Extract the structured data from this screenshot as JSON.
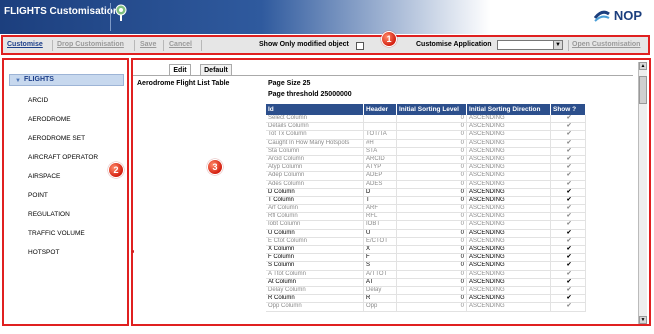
{
  "header": {
    "title": "FLIGHTS Customisation",
    "logo_text": "NOP"
  },
  "toolbar": {
    "customise": "Customise",
    "drop_customisation": "Drop Customisation",
    "save": "Save",
    "cancel": "Cancel",
    "show_modified_label": "Show Only modified object",
    "customise_application_label": "Customise Application",
    "customise_application_value": "",
    "open_customisation": "Open Customisation"
  },
  "badges": {
    "b1": "1",
    "b2": "2",
    "b3": "3"
  },
  "sidebar": {
    "title": "FLIGHTS",
    "items": [
      "ARCID",
      "AERODROME",
      "AERODROME SET",
      "AIRCRAFT OPERATOR",
      "AIRSPACE",
      "POINT",
      "REGULATION",
      "TRAFFIC VOLUME",
      "HOTSPOT"
    ]
  },
  "main": {
    "tabs": [
      "Edit",
      "Default"
    ],
    "table_title": "Aerodrome Flight List Table",
    "page_size": "Page Size 25",
    "page_threshold": "Page threshold 25000000",
    "columns": [
      "Id",
      "Header",
      "Initial Sorting Level",
      "Initial Sorting Direction",
      "Show ?"
    ],
    "rows": [
      [
        "Select Column",
        "",
        "0",
        "ASCENDING",
        "✔",
        "grey"
      ],
      [
        "Details Column",
        "",
        "0",
        "ASCENDING",
        "✔",
        "grey"
      ],
      [
        "Tot Tx Column",
        "TOT/TA",
        "0",
        "ASCENDING",
        "✔",
        "grey"
      ],
      [
        "Caught In How Many Hotspots",
        "#H",
        "0",
        "ASCENDING",
        "✔",
        "grey"
      ],
      [
        "Sta Column",
        "STA",
        "0",
        "ASCENDING",
        "✔",
        "grey"
      ],
      [
        "Arcid Column",
        "ARCID",
        "0",
        "ASCENDING",
        "✔",
        "grey"
      ],
      [
        "Atyp Column",
        "ATYP",
        "0",
        "ASCENDING",
        "✔",
        "grey"
      ],
      [
        "Adep Column",
        "ADEP",
        "0",
        "ASCENDING",
        "✔",
        "grey"
      ],
      [
        "Ades Column",
        "ADES",
        "0",
        "ASCENDING",
        "✔",
        "grey"
      ],
      [
        "D Column",
        "D",
        "0",
        "ASCENDING",
        "✔",
        "black"
      ],
      [
        "T Column",
        "T",
        "0",
        "ASCENDING",
        "✔",
        "black"
      ],
      [
        "Arf Column",
        "ARF",
        "0",
        "ASCENDING",
        "✔",
        "grey"
      ],
      [
        "Rfl Column",
        "RFL",
        "0",
        "ASCENDING",
        "✔",
        "grey"
      ],
      [
        "Iobt Column",
        "IOBT",
        "0",
        "ASCENDING",
        "✔",
        "grey"
      ],
      [
        "U Column",
        "U",
        "0",
        "ASCENDING",
        "✔",
        "black"
      ],
      [
        "E Ctot Column",
        "E/CTOT",
        "0",
        "ASCENDING",
        "✔",
        "grey"
      ],
      [
        "X Column",
        "X",
        "0",
        "ASCENDING",
        "✔",
        "black"
      ],
      [
        "F Column",
        "F",
        "0",
        "ASCENDING",
        "✔",
        "black"
      ],
      [
        "S Column",
        "S",
        "0",
        "ASCENDING",
        "✔",
        "black"
      ],
      [
        "A Ttot Column",
        "A/TTOT",
        "0",
        "ASCENDING",
        "✔",
        "grey"
      ],
      [
        "At Column",
        "AT",
        "0",
        "ASCENDING",
        "✔",
        "black"
      ],
      [
        "Delay Column",
        "Delay",
        "0",
        "ASCENDING",
        "✔",
        "grey"
      ],
      [
        "R Column",
        "R",
        "0",
        "ASCENDING",
        "✔",
        "black"
      ],
      [
        "Opp Column",
        "Opp",
        "0",
        "ASCENDING",
        "✔",
        "grey"
      ]
    ]
  },
  "colors": {
    "accent": "#1d3f8a",
    "header_blue": "#1c3f7e",
    "table_head": "#2c4f8c",
    "annotation_red": "#e02020"
  }
}
